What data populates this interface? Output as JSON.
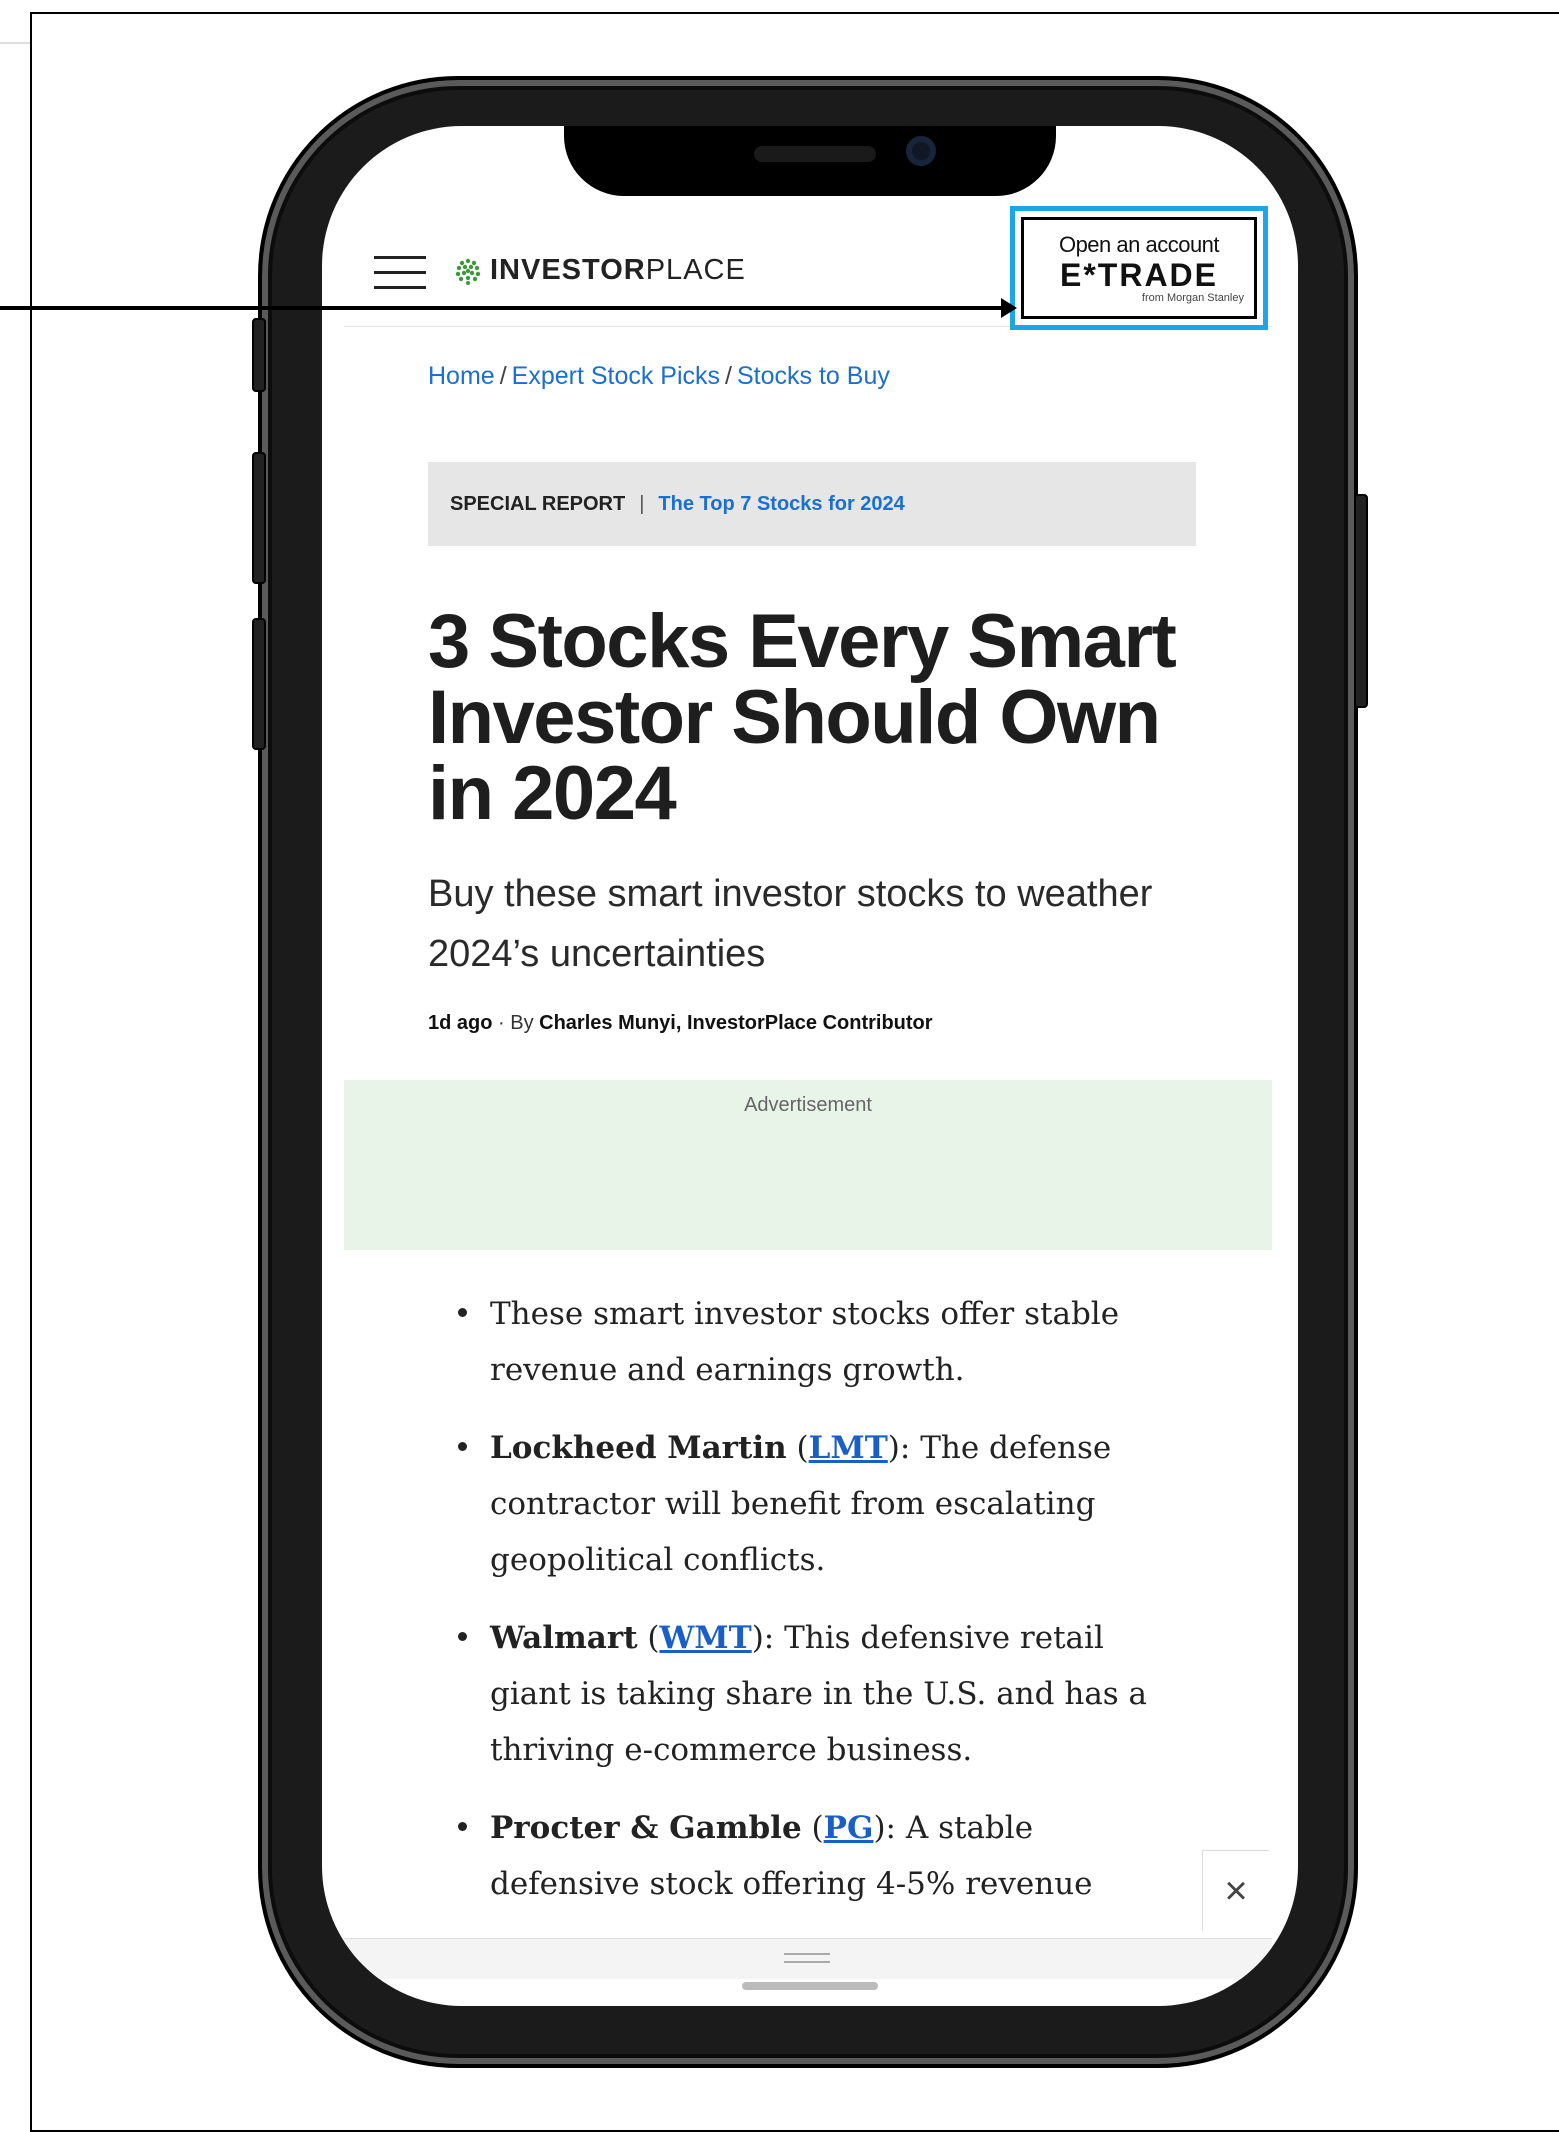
{
  "header": {
    "logo_bold": "INVESTOR",
    "logo_light": "PLACE"
  },
  "ad_badge": {
    "line1": "Open an account",
    "line2": "E*TRADE",
    "line3": "from Morgan Stanley"
  },
  "breadcrumb": {
    "items": [
      "Home",
      "Expert Stock Picks",
      "Stocks to Buy"
    ],
    "separator": "/"
  },
  "special_report": {
    "label": "SPECIAL REPORT",
    "divider": "|",
    "link": "The Top 7 Stocks for 2024"
  },
  "article": {
    "headline": "3 Stocks Every Smart Investor Should Own in 2024",
    "subheadline": "Buy these smart investor stocks to weather 2024’s uncertainties",
    "byline_time": "1d ago",
    "byline_by": "· By",
    "byline_author": "Charles Munyi, InvestorPlace Contributor"
  },
  "ad_block": {
    "label": "Advertisement"
  },
  "bullets": [
    {
      "text": "These smart investor stocks offer stable revenue and earnings growth."
    },
    {
      "name": "Lockheed Martin",
      "open": " (",
      "ticker": "LMT",
      "close": "): ",
      "text": "The defense contractor will benefit from escalating geopolitical conflicts."
    },
    {
      "name": "Walmart",
      "open": " (",
      "ticker": "WMT",
      "close": "): ",
      "text": "This defensive retail giant is taking share in the U.S. and has a thriving e-commerce business."
    },
    {
      "name": "Procter & Gamble",
      "open": " (",
      "ticker": "PG",
      "close": "): ",
      "text": "A stable defensive stock offering 4-5% revenue"
    }
  ],
  "close_button": {
    "glyph": "×"
  },
  "colors": {
    "link_blue": "#1a6fd0",
    "highlight_border": "#1aa7e8",
    "ad_background": "#e8f4e8"
  },
  "icons": {
    "menu": "hamburger-menu-icon",
    "logo": "investorplace-logo-icon",
    "close": "close-icon"
  }
}
